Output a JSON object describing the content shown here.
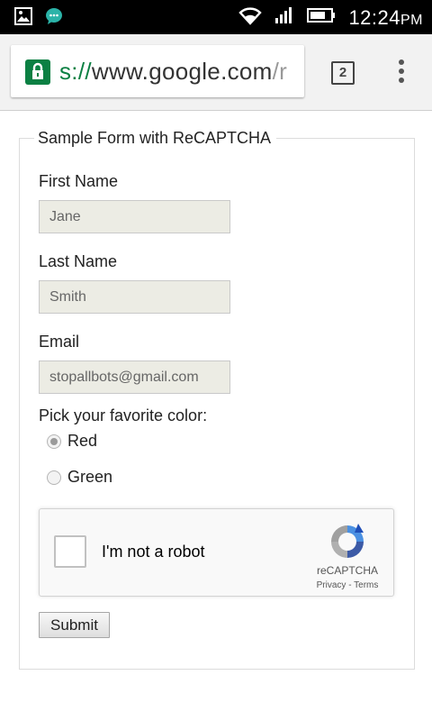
{
  "status_bar": {
    "time": "12:24",
    "ampm": "PM",
    "icons": [
      "gallery-icon",
      "chat-icon",
      "wifi-icon",
      "signal-icon",
      "battery-icon"
    ]
  },
  "browser": {
    "url_scheme_fragment": "s://",
    "url_host": "www.google.com",
    "url_path_fragment": "/r",
    "tab_count": "2",
    "lock_color": "#0b8043"
  },
  "form": {
    "legend": "Sample Form with ReCAPTCHA",
    "first_name_label": "First Name",
    "first_name_value": "Jane",
    "last_name_label": "Last Name",
    "last_name_value": "Smith",
    "email_label": "Email",
    "email_value": "stopallbots@gmail.com",
    "color_prompt": "Pick your favorite color:",
    "color_options": [
      {
        "label": "Red",
        "checked": true
      },
      {
        "label": "Green",
        "checked": false
      }
    ],
    "submit_label": "Submit"
  },
  "recaptcha": {
    "label": "I'm not a robot",
    "brand": "reCAPTCHA",
    "links": "Privacy - Terms"
  }
}
